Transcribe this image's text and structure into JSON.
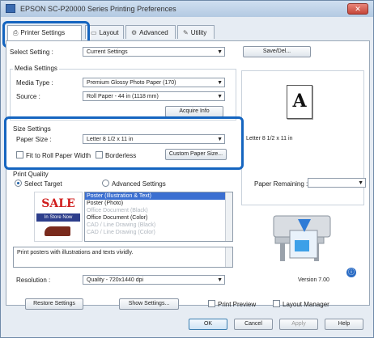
{
  "window": {
    "title": "EPSON SC-P20000 Series Printing Preferences",
    "close_label": "✕"
  },
  "tabs": [
    {
      "label": "Printer Settings",
      "icon": "printer-icon"
    },
    {
      "label": "Layout",
      "icon": "layout-icon"
    },
    {
      "label": "Advanced",
      "icon": "gear-icon"
    },
    {
      "label": "Utility",
      "icon": "wrench-icon"
    }
  ],
  "select_setting": {
    "label": "Select Setting :",
    "value": "Current Settings",
    "save_del": "Save/Del..."
  },
  "media": {
    "title": "Media Settings",
    "media_type_label": "Media Type :",
    "media_type_value": "Premium Glossy Photo Paper (170)",
    "source_label": "Source :",
    "source_value": "Roll Paper - 44 in (1118 mm)",
    "acquire_info": "Acquire Info"
  },
  "size": {
    "title": "Size Settings",
    "paper_size_label": "Paper Size :",
    "paper_size_value": "Letter 8 1/2 x 11 in",
    "fit_roll": "Fit to Roll Paper Width",
    "borderless": "Borderless",
    "custom_paper": "Custom Paper Size..."
  },
  "print_quality": {
    "title": "Print Quality",
    "select_target": "Select Target",
    "advanced_settings": "Advanced Settings",
    "targets": [
      "Poster (Illustration & Text)",
      "Poster (Photo)",
      "Office Document (Black)",
      "Office Document (Color)",
      "CAD / Line Drawing (Black)",
      "CAD / Line Drawing (Color)"
    ],
    "description": "Print posters with illustrations and texts vividly.",
    "sale_text": "SALE",
    "in_store_text": "In Store Now"
  },
  "resolution": {
    "label": "Resolution :",
    "value": "Quality - 720x1440 dpi"
  },
  "preview": {
    "letter": "A",
    "paper_desc": "Letter 8 1/2 x 11 in",
    "paper_remaining_label": "Paper Remaining :",
    "version": "Version 7.00"
  },
  "footer": {
    "restore": "Restore Settings",
    "show_settings": "Show Settings...",
    "print_preview": "Print Preview",
    "layout_manager": "Layout Manager",
    "ok": "OK",
    "cancel": "Cancel",
    "apply": "Apply",
    "help": "Help"
  },
  "colors": {
    "highlight": "#1565c0",
    "selected_item": "#3b6fd1"
  }
}
